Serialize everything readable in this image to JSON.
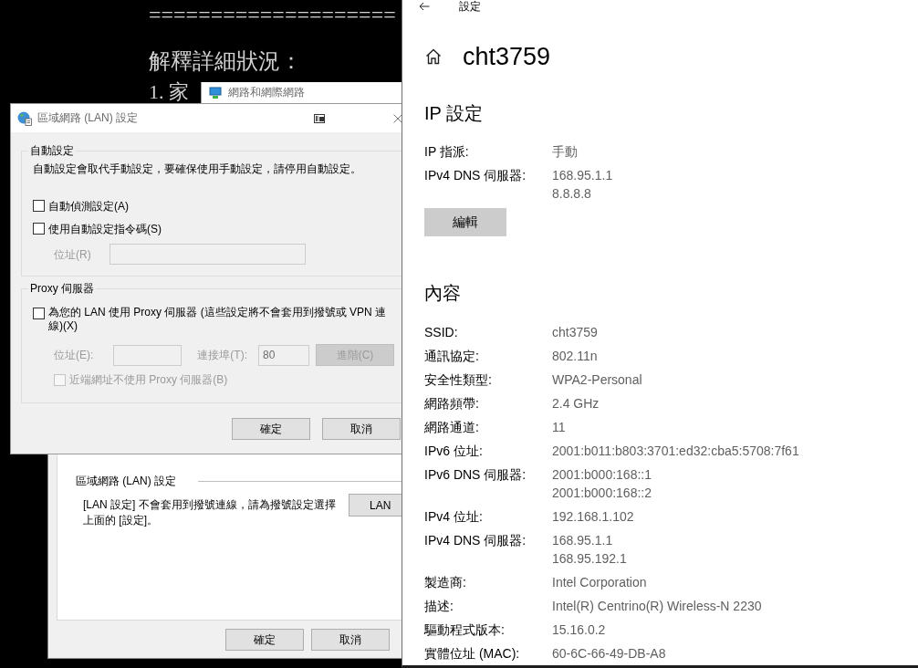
{
  "document": {
    "rule": "====================",
    "heading": "解釋詳細狀況：",
    "list_item": "1. 家"
  },
  "network_window": {
    "title": "網路和網際網路"
  },
  "internet_options": {
    "group_title": "區域網路 (LAN) 設定",
    "description": "[LAN 設定] 不會套用到撥號連線，請為撥號設定選擇上面的 [設定]。",
    "lan_button": "LAN",
    "buttons": [
      "確定",
      "取消"
    ]
  },
  "lan_dialog": {
    "title": "區域網路 (LAN) 設定",
    "auto_config": {
      "title": "自動設定",
      "description": "自動設定會取代手動設定，要確保使用手動設定，請停用自動設定。",
      "options": [
        {
          "label": "自動偵測設定(A)",
          "checked": false
        },
        {
          "label": "使用自動設定指令碼(S)",
          "checked": false
        }
      ],
      "address": {
        "label": "位址(R)",
        "disabled": true
      }
    },
    "proxy": {
      "title": "Proxy 伺服器",
      "use_proxy": {
        "label": "為您的 LAN 使用 Proxy 伺服器 (這些設定將不會套用到撥號或 VPN 連線)(X)",
        "checked": false
      },
      "address": {
        "label": "位址(E):",
        "disabled": true
      },
      "port": {
        "label": "連接埠(T):",
        "value": "80",
        "disabled": true
      },
      "advanced_button": {
        "label": "進階(C)",
        "disabled": true
      },
      "bypass_local": {
        "label": "近端網址不使用 Proxy 伺服器(B)",
        "checked": false,
        "disabled": true
      }
    },
    "buttons": [
      "確定",
      "取消"
    ]
  },
  "settings": {
    "nav_title": "設定",
    "network_name": "cht3759",
    "ip_settings": {
      "title": "IP 設定",
      "rows": [
        {
          "label": "IP 指派:",
          "values": [
            "手動"
          ]
        },
        {
          "label": "IPv4 DNS 伺服器:",
          "values": [
            "168.95.1.1",
            "8.8.8.8"
          ]
        }
      ],
      "edit_button": "編輯"
    },
    "properties": {
      "title": "內容",
      "rows": [
        {
          "label": "SSID:",
          "values": [
            "cht3759"
          ]
        },
        {
          "label": "通訊協定:",
          "values": [
            "802.11n"
          ]
        },
        {
          "label": "安全性類型:",
          "values": [
            "WPA2-Personal"
          ]
        },
        {
          "label": "網路頻帶:",
          "values": [
            "2.4 GHz"
          ]
        },
        {
          "label": "網路通道:",
          "values": [
            "11"
          ]
        },
        {
          "label": "IPv6 位址:",
          "values": [
            "2001:b011:b803:3701:ed32:cba5:5708:7f61"
          ]
        },
        {
          "label": "IPv6 DNS 伺服器:",
          "values": [
            "2001:b000:168::1",
            "2001:b000:168::2"
          ]
        },
        {
          "label": "IPv4 位址:",
          "values": [
            "192.168.1.102"
          ]
        },
        {
          "label": "IPv4 DNS 伺服器:",
          "values": [
            "168.95.1.1",
            "168.95.192.1"
          ]
        },
        {
          "label": "製造商:",
          "values": [
            "Intel Corporation"
          ]
        },
        {
          "label": "描述:",
          "values": [
            "Intel(R) Centrino(R) Wireless-N 2230"
          ]
        },
        {
          "label": "驅動程式版本:",
          "values": [
            "15.16.0.2"
          ]
        },
        {
          "label": "實體位址 (MAC):",
          "values": [
            "60-6C-66-49-DB-A8"
          ]
        }
      ]
    }
  }
}
